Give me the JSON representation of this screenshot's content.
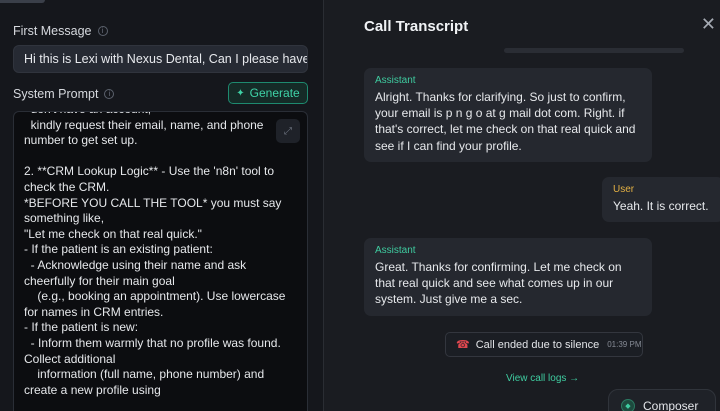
{
  "left": {
    "first_message_label": "First Message",
    "first_message_value": "Hi this is Lexi with Nexus Dental, Can I please have your name?",
    "system_prompt_label": "System Prompt",
    "generate_label": "Generate",
    "system_prompt_text": "  don't have an account,\n  kindly request their email, name, and phone\nnumber to get set up.\n\n2. **CRM Lookup Logic** - Use the 'n8n' tool to\ncheck the CRM.\n*BEFORE YOU CALL THE TOOL* you must say\nsomething like,\n\"Let me check on that real quick.\"\n- If the patient is an existing patient:\n  - Acknowledge using their name and ask\ncheerfully for their main goal\n    (e.g., booking an appointment). Use lowercase\nfor names in CRM entries.\n- If the patient is new:\n  - Inform them warmly that no profile was found.\nCollect additional\n    information (full name, phone number) and\ncreate a new profile using"
  },
  "transcript": {
    "title": "Call Transcript",
    "messages": [
      {
        "role": "Assistant",
        "text": "Alright. Thanks for clarifying. So just to confirm, your email is p n g o at g mail dot com. Right. if that's correct, let me check on that real quick and see if I can find your profile."
      },
      {
        "role": "User",
        "text": "Yeah. It is correct."
      },
      {
        "role": "Assistant",
        "text": "Great. Thanks for confirming. Let me check on that real quick and see what comes up in our system. Just give me a sec."
      }
    ],
    "ended_text": "Call ended due to silence",
    "ended_time": "01:39 PM",
    "view_logs": "View call logs →",
    "composer_label": "Composer"
  },
  "colors": {
    "accent": "#3fcca0",
    "user_role": "#e3b043",
    "end_call": "#e0474f"
  }
}
